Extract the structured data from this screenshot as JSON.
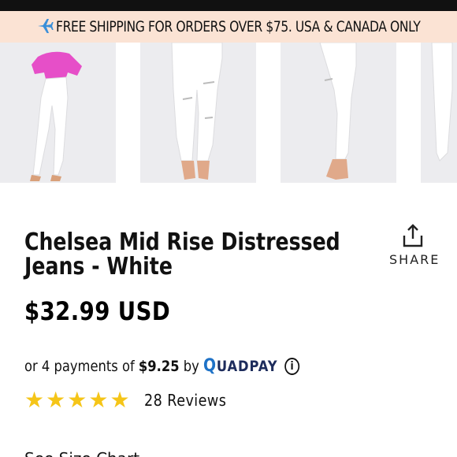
{
  "promo": {
    "icon": "airplane-icon",
    "text": "FREE SHIPPING FOR ORDERS OVER $75. USA & CANADA ONLY"
  },
  "gallery": {
    "thumbnails": [
      "product-image-1",
      "product-image-2",
      "product-image-3",
      "product-image-4"
    ]
  },
  "product": {
    "title": "Chelsea Mid Rise Distressed Jeans - White",
    "price": "$32.99 USD"
  },
  "share": {
    "icon": "share-icon",
    "label": "SHARE"
  },
  "installments": {
    "prefix": "or 4 payments of",
    "amount": "$9.25",
    "by": "by",
    "provider_q": "Q",
    "provider_rest": "UADPAY",
    "info_icon": "info-icon"
  },
  "rating": {
    "stars": 5,
    "max_stars": 5,
    "reviews_label": "28 Reviews"
  },
  "size_chart": {
    "label": "See Size Chart"
  },
  "colors": {
    "promo_bg": "#fbe3d4",
    "star": "#f5c518",
    "quadpay_blue": "#1e72c7"
  }
}
